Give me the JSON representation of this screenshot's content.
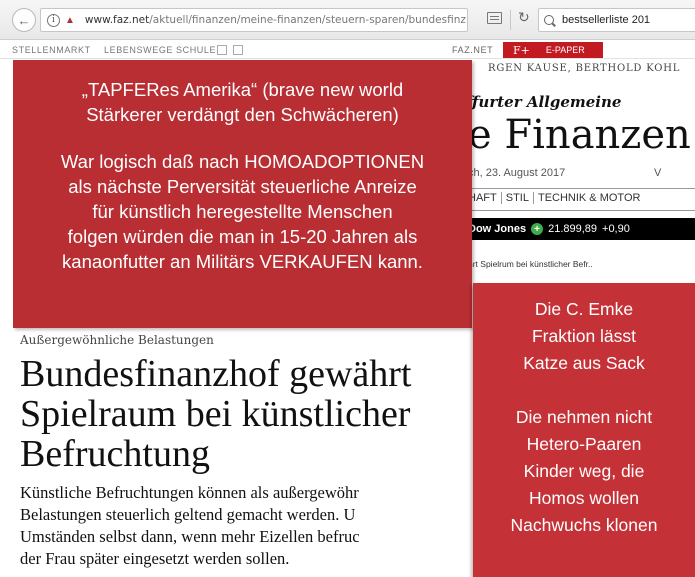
{
  "browser": {
    "url_domain": "www.faz.net",
    "url_path": "/aktuell/finanzen/meine-finanzen/steuern-sparen/bundesfinz",
    "search_text": "bestsellerliste 201"
  },
  "topnav": {
    "items": [
      "STELLENMARKT",
      "LEBENSWEGE",
      "SCHULE"
    ],
    "faz_net": "FAZ.NET",
    "epaper_icon": "F+",
    "epaper_label": "E-PAPER"
  },
  "header": {
    "authors": "RGEN KAUSE, BERTHOLD KOHL",
    "masthead": "ffurter Allgemeine",
    "section_title": "e Finanzen",
    "date": "ch, 23. August 2017",
    "date_tail": "V",
    "categories": [
      "HAFT",
      "STIL",
      "TECHNIK & MOTOR"
    ],
    "ticker": {
      "name": "Dow Jones",
      "value": "21.899,89",
      "change": "+0,90"
    },
    "related": "hrt Spielrum bei künstlicher Befr.."
  },
  "article": {
    "kicker": "Außergewöhnliche Belastungen",
    "headline_lines": [
      "Bundesfinanzhof gewährt",
      "Spielraum bei künstlicher",
      "Befruchtung"
    ],
    "lead_lines": [
      "Künstliche Befruchtungen können als außergewöhr",
      "Belastungen steuerlich geltend gemacht werden. U",
      "Umständen selbst dann, wenn mehr Eizellen befruc",
      "der Frau später eingesetzt werden sollen."
    ]
  },
  "overlay_main": {
    "lines_a": [
      "„TAPFERes Amerika“ (brave new world",
      "Stärkerer verdängt den Schwächeren)"
    ],
    "lines_b": [
      "War logisch daß nach HOMOADOPTIONEN",
      "als nächste Perversität steuerliche Anreize",
      "für künstlich heregestellte Menschen",
      "folgen würden die man in 15-20 Jahren als",
      "kanaonfutter an Militärs VERKAUFEN kann."
    ]
  },
  "overlay_side": {
    "lines_a": [
      "Die C. Emke",
      "Fraktion lässt",
      "Katze aus Sack"
    ],
    "lines_b": [
      "Die nehmen nicht",
      "Hetero-Paaren",
      "Kinder weg, die",
      "Homos wollen",
      "Nachwuchs klonen"
    ]
  }
}
